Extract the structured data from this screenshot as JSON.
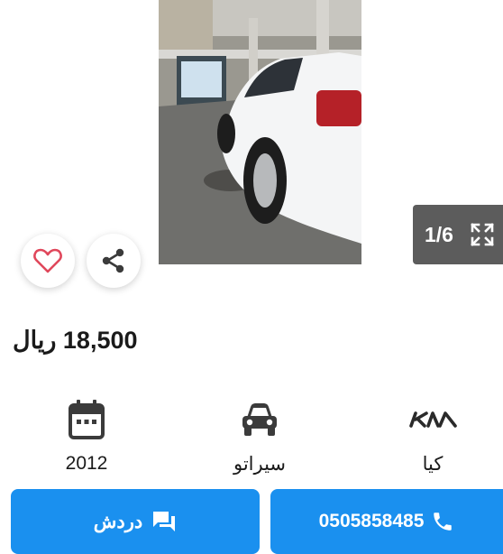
{
  "gallery": {
    "counter": "1/6",
    "prev_icon": "chevron-left-icon",
    "next_icon": "chevron-right-icon",
    "expand_icon": "fullscreen-icon"
  },
  "actions_top": {
    "favorite_icon": "heart-icon",
    "share_icon": "share-icon"
  },
  "price": "18,500 ريال",
  "specs": [
    {
      "icon": "calendar-icon",
      "value": "2012"
    },
    {
      "icon": "car-icon",
      "value": "سيراتو"
    },
    {
      "icon": "kia-logo",
      "value": "كيا"
    }
  ],
  "buttons": {
    "chat": {
      "label": "دردش",
      "icon": "chat-icon"
    },
    "call": {
      "label": "0505858485",
      "icon": "phone-icon"
    }
  },
  "colors": {
    "primary": "#1a90ef",
    "heart": "#e0475b",
    "counter_bg": "#5c5c5c",
    "icon_dark": "#3b3b3b"
  }
}
